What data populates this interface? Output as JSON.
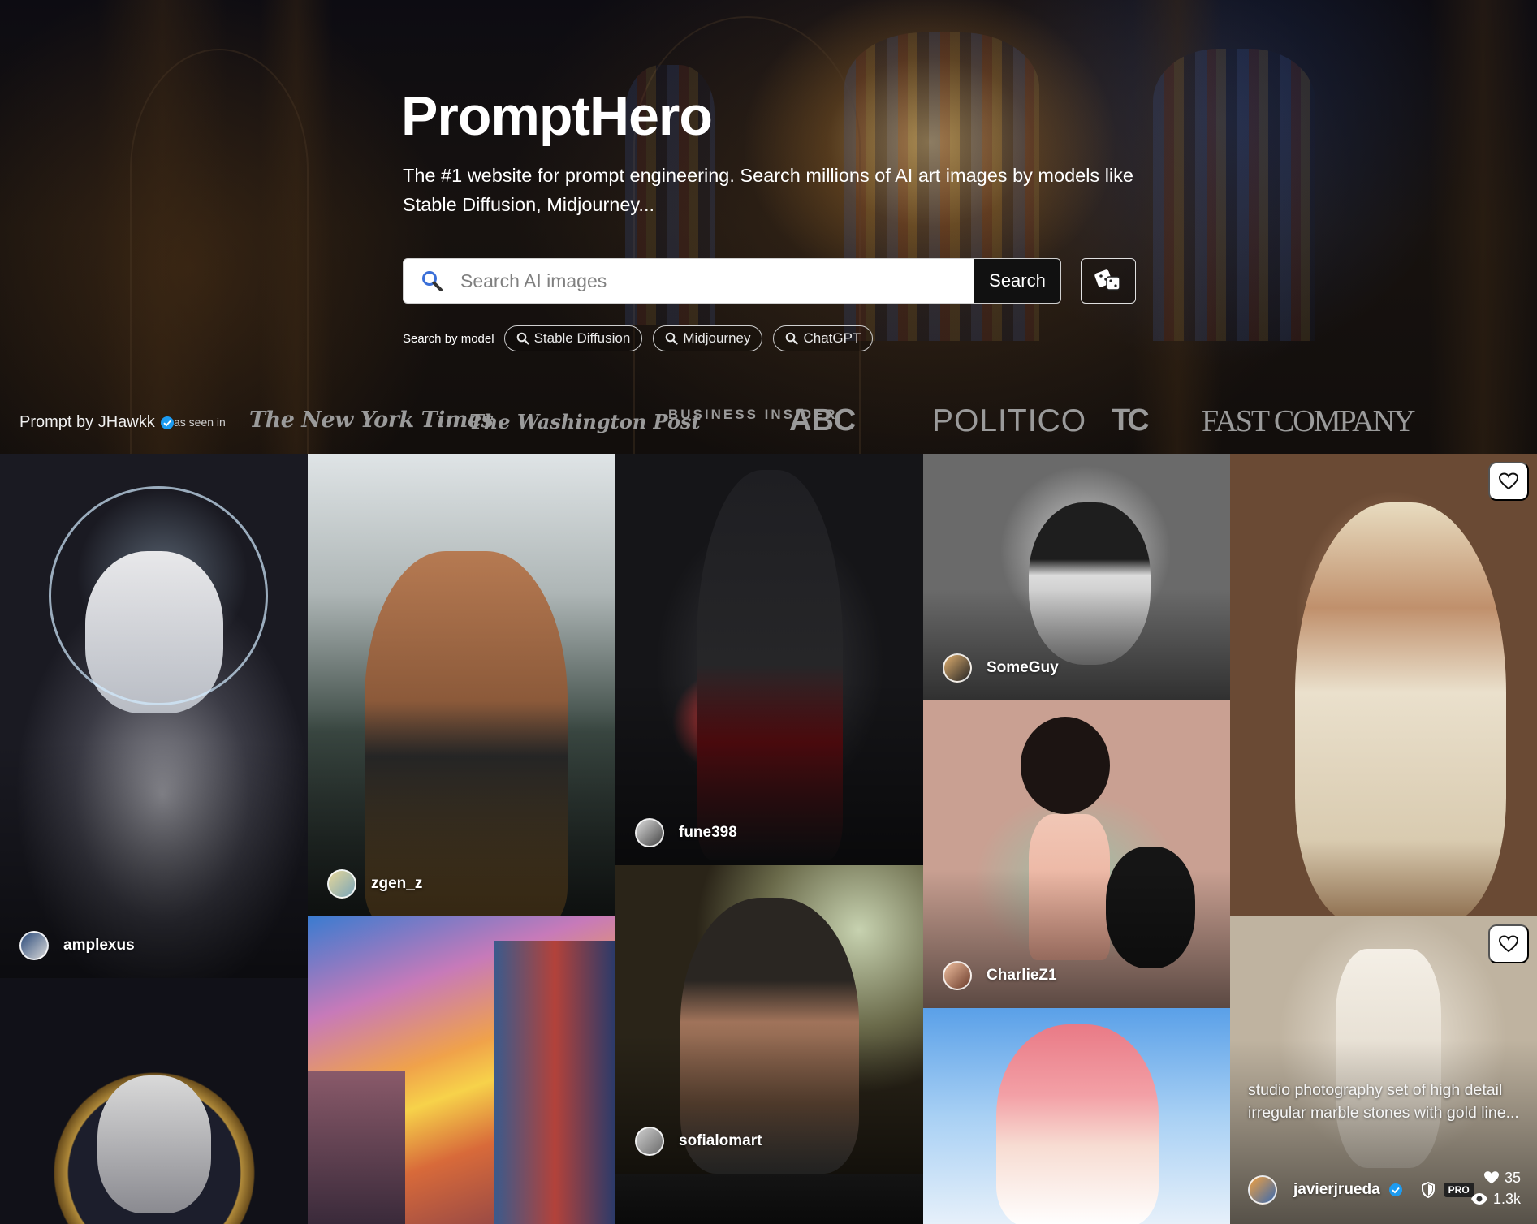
{
  "hero": {
    "brand": "PromptHero",
    "tagline": "The #1 website for prompt engineering. Search millions of AI art images by models like Stable Diffusion, Midjourney...",
    "search": {
      "placeholder": "Search AI images",
      "button_label": "Search"
    },
    "models_label": "Search by model",
    "models": [
      "Stable Diffusion",
      "Midjourney",
      "ChatGPT"
    ],
    "credit": "Prompt by JHawkk",
    "seen_label": "as seen in",
    "press": [
      "The New York Times",
      "The Washington Post",
      "BUSINESS INSIDER",
      "ABC",
      "POLITICO",
      "TC",
      "FAST COMPANY"
    ]
  },
  "cards": [
    {
      "author": "amplexus"
    },
    {
      "author": "zgen_z"
    },
    {
      "author": "fune398"
    },
    {
      "author": "SomeGuy"
    },
    {
      "author": "CharlieZ1"
    },
    {
      "author": "sofialomart"
    },
    {
      "author": "javierjrueda",
      "prompt": "studio photography set of high detail irregular marble stones with gold line...",
      "badge": "PRO",
      "likes": "35",
      "views": "1.3k"
    }
  ],
  "icons": {
    "search": "magnifier-icon",
    "random": "dice-icon",
    "verified": "verified-badge-icon",
    "like": "heart-icon",
    "views": "eye-icon",
    "shield": "shield-icon"
  },
  "colors": {
    "accent": "#1d9bf0",
    "search_button": "#111111"
  }
}
